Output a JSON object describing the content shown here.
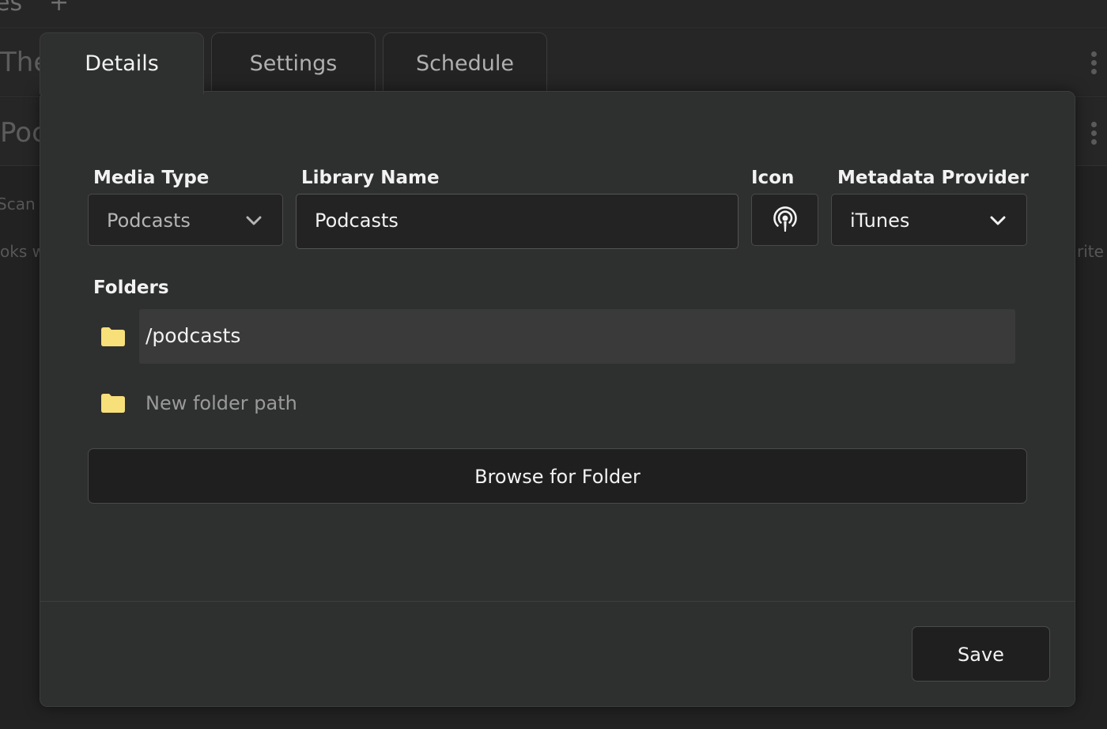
{
  "background": {
    "topbar_text": "es",
    "topbar_plus": "+",
    "rows": [
      "The",
      "Poc"
    ],
    "small_texts": [
      "Scan w",
      "oks w",
      "rite"
    ]
  },
  "tabs": [
    {
      "label": "Details",
      "active": true
    },
    {
      "label": "Settings",
      "active": false
    },
    {
      "label": "Schedule",
      "active": false
    }
  ],
  "form": {
    "media_type": {
      "label": "Media Type",
      "value": "Podcasts"
    },
    "library_name": {
      "label": "Library Name",
      "value": "Podcasts"
    },
    "icon": {
      "label": "Icon",
      "icon_name": "podcast-icon"
    },
    "metadata_provider": {
      "label": "Metadata Provider",
      "value": "iTunes"
    }
  },
  "folders": {
    "label": "Folders",
    "items": [
      "/podcasts"
    ],
    "new_placeholder": "New folder path",
    "browse_label": "Browse for Folder"
  },
  "footer": {
    "save_label": "Save"
  },
  "colors": {
    "folder_icon": "#f7df7a",
    "modal_bg": "#2e2f2f",
    "field_bg": "#232323"
  }
}
